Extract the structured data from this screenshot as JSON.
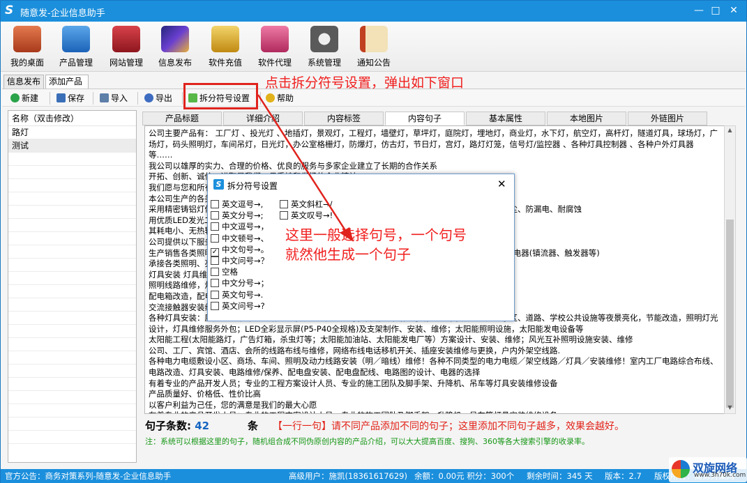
{
  "app": {
    "title": "随意发-企业信息助手",
    "logo": "S"
  },
  "window_controls": [
    "—",
    "□",
    "✕"
  ],
  "toolbar": [
    {
      "label": "我的桌面",
      "icon": "house-icon",
      "color": "#c2552a"
    },
    {
      "label": "产品管理",
      "icon": "cloud-icon",
      "color": "#2b7fd6"
    },
    {
      "label": "网站管理",
      "icon": "building-icon",
      "color": "#b8232b"
    },
    {
      "label": "信息发布",
      "icon": "magic-wand-icon",
      "color": "#3a3fa8"
    },
    {
      "label": "软件充值",
      "icon": "chart-bars-icon",
      "color": "#d4a017"
    },
    {
      "label": "软件代理",
      "icon": "gift-icon",
      "color": "#d2477a"
    },
    {
      "label": "系统管理",
      "icon": "gear-icon",
      "color": "#555555"
    },
    {
      "label": "通知公告",
      "icon": "notebook-icon",
      "color": "#c9861f"
    }
  ],
  "doc_tabs": [
    "信息发布",
    "添加产品"
  ],
  "sub_toolbar": {
    "new": "新建",
    "save": "保存",
    "import": "导入",
    "export": "导出",
    "split": "拆分符号设置",
    "help": "帮助"
  },
  "annotation_top": "点击拆分符号设置，弹出如下窗口",
  "left_panel": {
    "header": "名称（双击修改）",
    "items": [
      "路灯",
      "测试"
    ]
  },
  "content_tabs": [
    "产品标题",
    "详细介绍",
    "内容标签",
    "内容句子",
    "基本属性",
    "本地图片",
    "外链图片"
  ],
  "content_text": "公司主要产品有： 工厂灯 、投光灯 、地插灯，景观灯，工程灯，墙壁灯，草坪灯，庭院灯，埋地灯，商业灯，水下灯，航空灯，高杆灯，隧道灯具，球场灯，广场灯，码头照明灯，车间吊灯，日光灯，办公室格栅灯，防爆灯，仿古灯，节日灯，宫灯，路灯灯笼，信号灯/监控器 、各种灯具控制器 、各种户外灯具器 等……\n我公司以雄厚的实力、合理的价格、优良的服务与多家企业建立了长期的合作关系\n开拓、创新、诚信，进取是我们一贯秉持和发扬的企业精神\n我们愿与您和所有新老客户携手共进，共创辉煌！\n本公司生产的各类灯具均采用进口先进的生产设备，拥有整套全自动化制造设备\n采用精密铸铝灯体，经表面静电喷涂处理，防腐耐磨，不易老化，弧形多角度折射强化玻璃，防水、防尘、防漏电、耐腐蚀\n用优质LED发光二极管作为光源，寿命长，光效高\n其耗电小、无热辐射，每天可比传统灯具节电数度，持续照明10小时\n公司提供以下服务\n生产销售各类照明灯具（户外灯、室内灯、路灯、太阳能灯、LED和各种商业、工业照明灯具等）、光源电器(镇流器、触发器等)\n承接各类照明、亮化工程的设计与施工\n灯具安装 灯具维修\n照明线路维修，灯光亮化维修\n配电箱改造，配电柜安装\n交流接触器安装维修\n各种灯具安装：庭院灯、草坪灯、路灯、景观灯、隧道灯等，商场、车站、乐场、旅游景点、工厂、小区、道路、学校公共设施等夜景亮化，节能改造，照明灯光设计，灯具维修服务外包；LED全彩显示屏(P5-P40全规格)及支架制作、安装、维修；太阳能照明设施，太阳能发电设备等\n太阳能工程(太阳能路灯，广告灯箱，杀虫灯等；太阳能加油站、太阳能发电厂等）方案设计、安装、维修；风光互补照明设施安装、维修\n公司、工厂、宾馆、酒店、会所的线路布线与维修，网络布线电话移机开关、插座安装维修与更换，户内外架空线路.\n各种电力电缆敷设小区、商场、车间、照明及动力线路安装（明／暗线）维修！各种不同类型的电力电缆／架空线路／灯具／安装维修！室内工厂电路综合布线、电路改造、灯具安装、电路维修/保养、配电盘安装、配电盘配线、电路图的设计、电器的选择\n有着专业的产品开发人员；专业的工程方案设计人员、专业的施工团队及脚手架、升降机、吊车等灯具安装维修设备\n产品质量好、价格低、性价比高\n以客户利益为己任，您的满意是我们的最大心愿\n有着专业的产品开发人员；专业的工程方案设计人员、专业的施工团队及脚手架、升降机、吊车等灯具安装维修设备",
  "sentence_count": {
    "label": "句子条数:",
    "value": "42",
    "unit": "条"
  },
  "hint": "【一行一句】请不同产品添加不同的句子；这里添加不同句子越多，效果会越好。",
  "note": "注：系统可以根据这里的句子，随机组合成不同伪原创内容的产品介绍，可以大大提高百度、搜狗、360等各大搜索引擎的收录率。",
  "dialog": {
    "title": "拆分符号设置",
    "options_left": [
      {
        "label": "英文逗号→,",
        "checked": false
      },
      {
        "label": "英文分号→;",
        "checked": false
      },
      {
        "label": "中文逗号→，",
        "checked": false
      },
      {
        "label": "中文顿号→、",
        "checked": false
      },
      {
        "label": "中文句号→。",
        "checked": true
      },
      {
        "label": "中文问号→？",
        "checked": false
      },
      {
        "label": "空格",
        "checked": false
      },
      {
        "label": "中文分号→；",
        "checked": false
      },
      {
        "label": "英文句号→.",
        "checked": false
      },
      {
        "label": "英文问号→?",
        "checked": false
      }
    ],
    "options_right": [
      {
        "label": "英文斜杠→/",
        "checked": false
      },
      {
        "label": "英文叹号→!",
        "checked": false
      }
    ],
    "callout": "这里一般选择句号，一个句号\n就然他生成一个句子"
  },
  "status": {
    "notice": "官方公告：商务对策系列-随意发-企业信息助手",
    "user": "高级用户：施凯(18361617629)",
    "balance": "余额：0.00元 积分：300个",
    "remaining": "剩余时间：345 天",
    "version": "版本：2.7",
    "rights": "版权所有：商务对策网"
  },
  "watermark": {
    "name": "双旋网络",
    "url": "www.3h70k.com"
  }
}
